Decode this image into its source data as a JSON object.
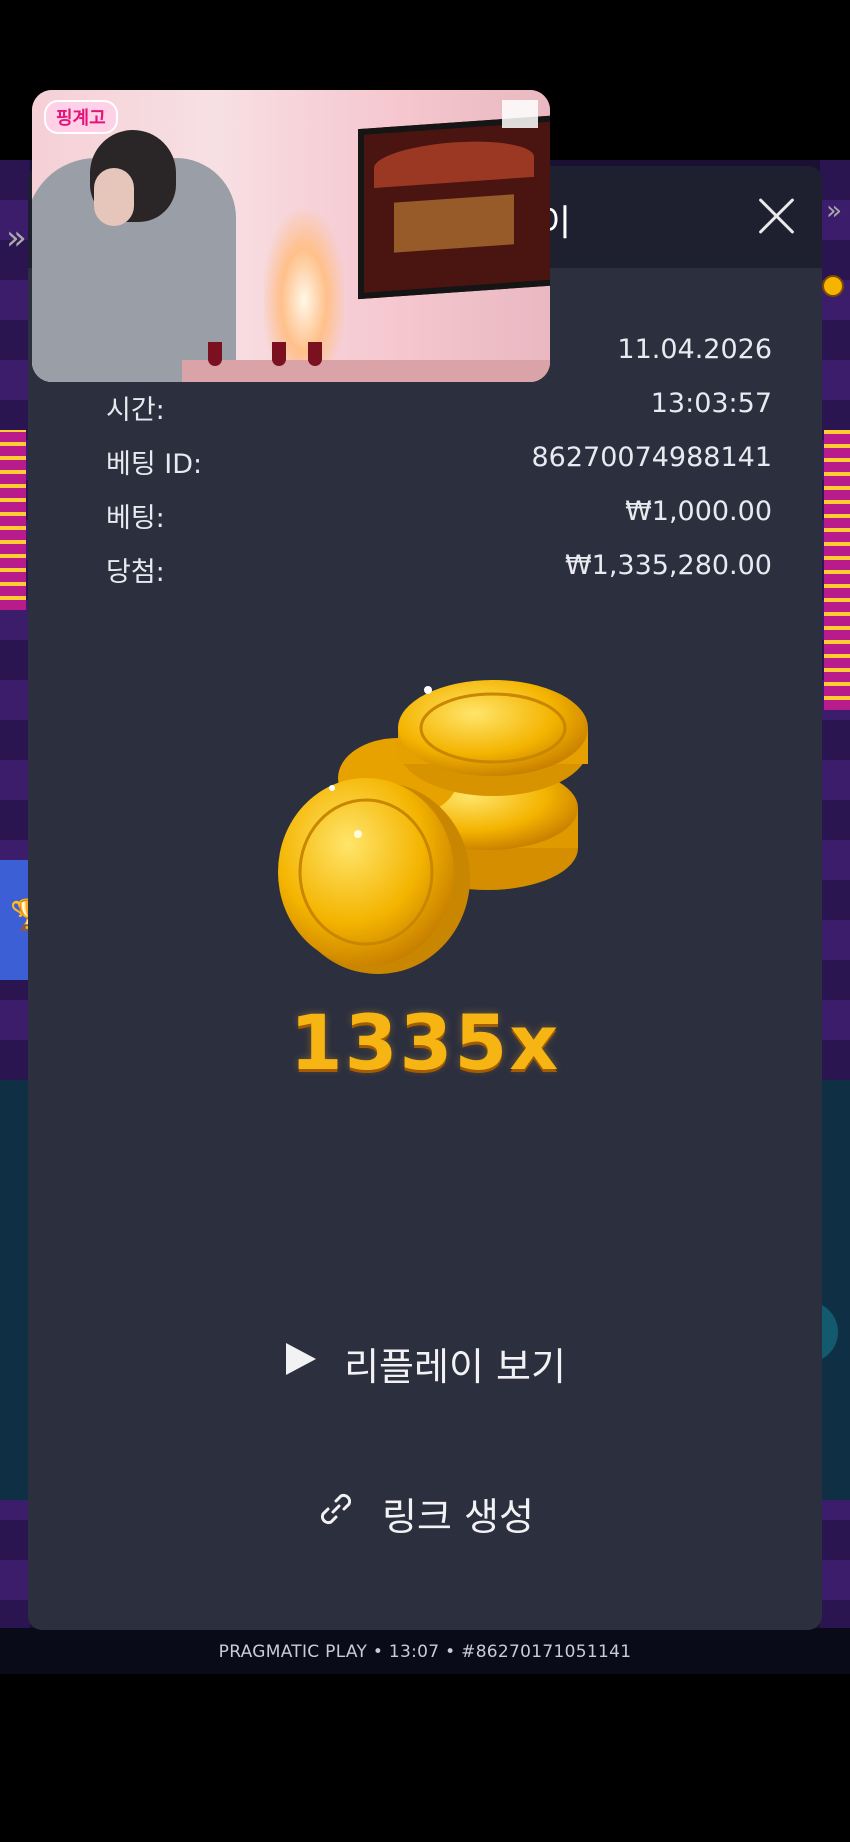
{
  "dialog": {
    "title_partial": "이",
    "close_label": "×"
  },
  "info": {
    "date_value": "11.04.2026",
    "rows": [
      {
        "label": "시간:",
        "value": "13:03:57"
      },
      {
        "label": "베팅 ID:",
        "value": "86270074988141"
      },
      {
        "label": "베팅:",
        "value": "₩1,000.00"
      },
      {
        "label": "당첨:",
        "value": "₩1,335,280.00"
      }
    ]
  },
  "win": {
    "multiplier": "1335x"
  },
  "actions": {
    "replay_label": "리플레이 보기",
    "link_label": "링크 생성"
  },
  "footer": {
    "text": "PRAGMATIC PLAY • 13:07 • #86270171051141"
  },
  "video_overlay": {
    "logo_text": "핑계고"
  },
  "icons": {
    "left_chevron": "double-chevron-left-icon",
    "right_chevron": "double-chevron-right-icon",
    "side_tab": "trophy-icon",
    "replay": "play-icon",
    "link": "link-icon",
    "close": "close-icon"
  },
  "colors": {
    "dialog_bg": "#2c2f3e",
    "header_bg": "#1e2030",
    "multiplier": "#f7b514",
    "side_tab": "#3d5fd6"
  }
}
